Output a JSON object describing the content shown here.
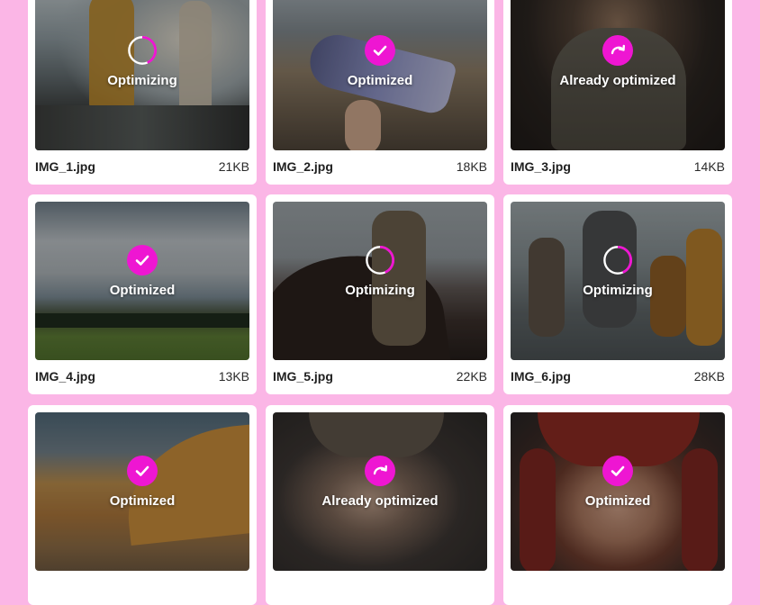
{
  "accent_color": "#ee16d2",
  "background_color": "#fbb6e6",
  "files": [
    {
      "name": "IMG_1.jpg",
      "size": "21KB",
      "status": "Optimizing",
      "status_icon": "spinner-icon"
    },
    {
      "name": "IMG_2.jpg",
      "size": "18KB",
      "status": "Optimized",
      "status_icon": "check-icon"
    },
    {
      "name": "IMG_3.jpg",
      "size": "14KB",
      "status": "Already optimized",
      "status_icon": "redo-arrow-icon"
    },
    {
      "name": "IMG_4.jpg",
      "size": "13KB",
      "status": "Optimized",
      "status_icon": "check-icon"
    },
    {
      "name": "IMG_5.jpg",
      "size": "22KB",
      "status": "Optimizing",
      "status_icon": "spinner-icon"
    },
    {
      "name": "IMG_6.jpg",
      "size": "28KB",
      "status": "Optimizing",
      "status_icon": "spinner-icon"
    },
    {
      "name": "",
      "size": "",
      "status": "Optimized",
      "status_icon": "check-icon"
    },
    {
      "name": "",
      "size": "",
      "status": "Already optimized",
      "status_icon": "redo-arrow-icon"
    },
    {
      "name": "",
      "size": "",
      "status": "Optimized",
      "status_icon": "check-icon"
    }
  ]
}
